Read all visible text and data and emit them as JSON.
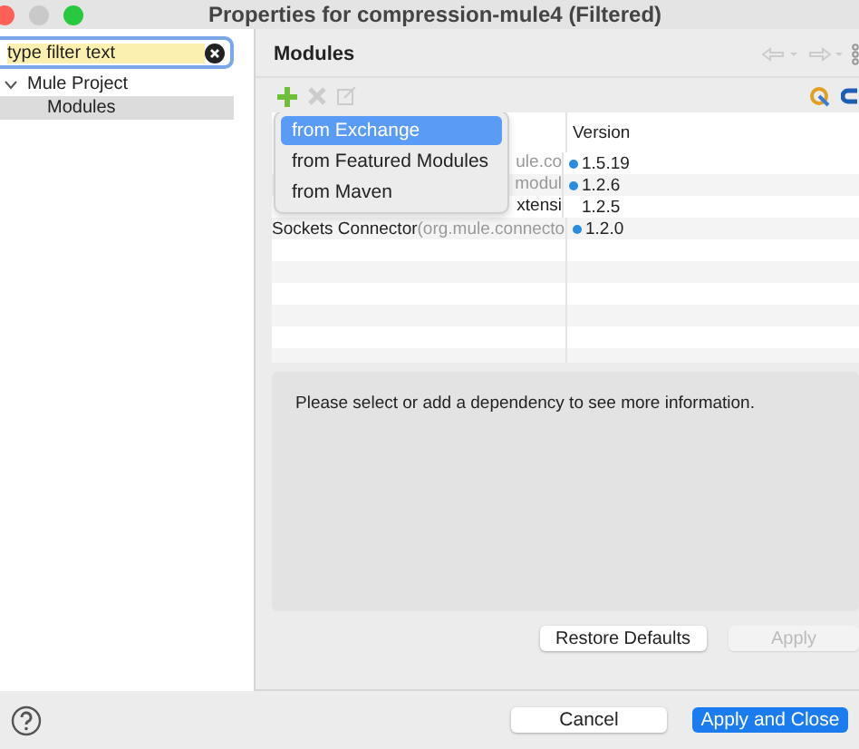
{
  "window": {
    "title": "Properties for compression-mule4 (Filtered)"
  },
  "filter": {
    "value": "type filter text"
  },
  "tree": [
    {
      "label": "Mule Project",
      "expanded": true,
      "selected": false,
      "children": [
        {
          "label": "Modules",
          "selected": true
        }
      ]
    }
  ],
  "page": {
    "title": "Modules"
  },
  "table": {
    "columns": [
      "Version"
    ],
    "rows": [
      {
        "detail": "ule.co",
        "version": "1.5.19",
        "flagged": true
      },
      {
        "detail": "modul",
        "version": "1.2.6",
        "flagged": true
      },
      {
        "name": "xtensi",
        "version": "1.2.5",
        "flagged": false
      },
      {
        "name": "Sockets Connector",
        "detail": "(org.mule.connecto",
        "version": "1.2.0",
        "flagged": true
      }
    ]
  },
  "menu": [
    {
      "label": "from Exchange",
      "selected": true
    },
    {
      "label": "from Featured Modules",
      "selected": false
    },
    {
      "label": "from Maven",
      "selected": false
    }
  ],
  "info": "Please select or add a dependency to see more information.",
  "page_buttons": [
    {
      "label": "Restore Defaults",
      "disabled": false
    },
    {
      "label": "Apply",
      "disabled": true
    }
  ],
  "dialog_buttons": [
    {
      "label": "Cancel",
      "kind": "default"
    },
    {
      "label": "Apply and Close",
      "kind": "primary"
    }
  ]
}
